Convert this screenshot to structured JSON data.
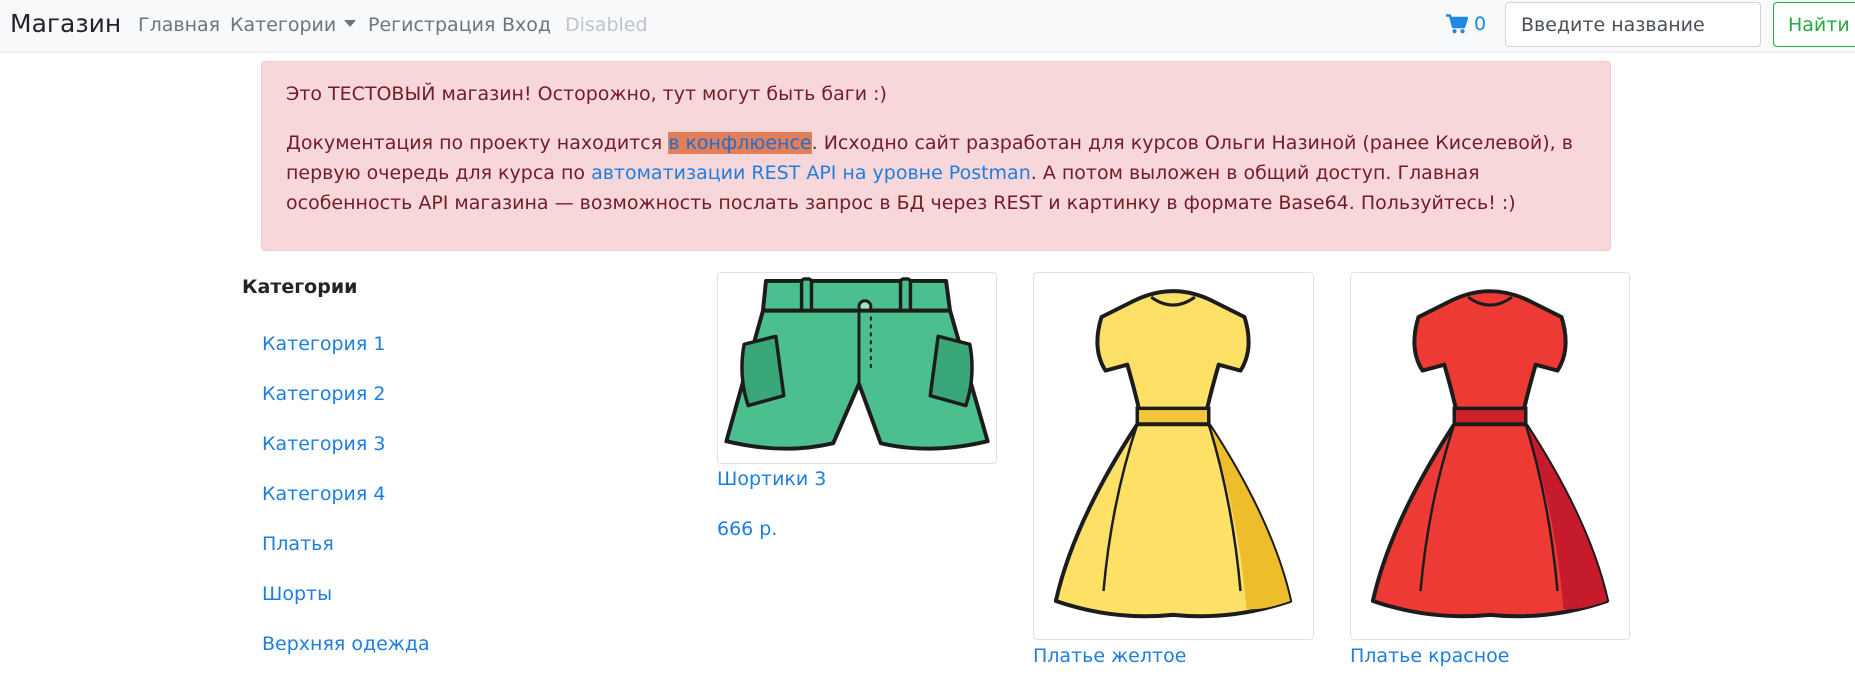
{
  "navbar": {
    "brand": "Магазин",
    "links": {
      "home": "Главная",
      "categories": "Категории",
      "register": "Регистрация",
      "login": "Вход",
      "disabled": "Disabled"
    },
    "cart_count": "0",
    "search_placeholder": "Введите название",
    "search_button": "Найти"
  },
  "alert": {
    "line1": "Это ТЕСТОВЫЙ магазин! Осторожно, тут могут быть баги :)",
    "p2_before_link1": "Документация по проекту находится ",
    "link1": "в конфлюенсе",
    "p2_after_link1": ".  Исходно сайт разработан для курсов Ольги Назиной (ранее Киселевой), в первую очередь для курса по ",
    "link2": "автоматизации REST API на уровне Postman",
    "p2_end": ". А потом выложен в общий доступ. Главная особенность API магазина — возможность послать запрос в БД через REST и картинку в формате Base64.  Пользуйтесь! :)"
  },
  "sidebar": {
    "title": "Категории",
    "items": [
      "Категория 1",
      "Категория 2",
      "Категория 3",
      "Категория 4",
      "Платья",
      "Шорты",
      "Верхняя одежда"
    ]
  },
  "products": [
    {
      "name": "Шортики 3",
      "price": "666 р.",
      "icon": "shorts-image"
    },
    {
      "name": "Платье желтое",
      "icon": "yellow-dress-image",
      "color": "#fde066"
    },
    {
      "name": "Платье красное",
      "icon": "red-dress-image",
      "color": "#ee3a35"
    }
  ],
  "colors": {
    "link": "#1e7ee0",
    "alert_bg": "#f8d7da",
    "alert_text": "#721c24",
    "success": "#28a745"
  }
}
